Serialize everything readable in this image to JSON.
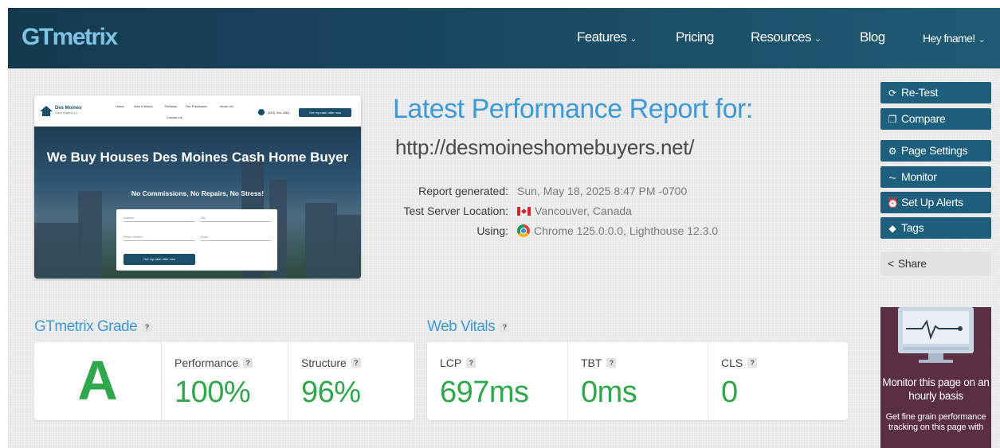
{
  "header": {
    "logo": "GTmetrix",
    "nav": [
      {
        "label": "Features",
        "dropdown": true
      },
      {
        "label": "Pricing",
        "dropdown": false
      },
      {
        "label": "Resources",
        "dropdown": true
      },
      {
        "label": "Blog",
        "dropdown": false
      },
      {
        "label": "Hey fname!",
        "dropdown": true
      }
    ],
    "chevron_glyph": "⌄"
  },
  "preview": {
    "brand_name": "Des Moines",
    "brand_sub": "Home Buyers LLC",
    "links": [
      "Home",
      "How it Works",
      "Reviews",
      "Our Purchases",
      "About Us",
      "Contact Us"
    ],
    "phone": "(515) 344-4361",
    "cta": "Get my cash offer now",
    "headline": "We Buy Houses Des Moines Cash Home Buyer",
    "subhead": "No Commissions, No Repairs, No Stress!",
    "form": {
      "address": "Address",
      "city": "City",
      "phone": "Phone Number",
      "email": "Email",
      "submit": "Get my cash offer now"
    }
  },
  "report": {
    "title": "Latest Performance Report for:",
    "url": "http://desmoineshomebuyers.net/",
    "meta": [
      {
        "label": "Report generated:",
        "value": "Sun, May 18, 2025 8:47 PM -0700"
      },
      {
        "label": "Test Server Location:",
        "value": "Vancouver, Canada"
      },
      {
        "label": "Using:",
        "value": "Chrome 125.0.0.0, Lighthouse 12.3.0"
      }
    ]
  },
  "sidebar": {
    "buttons": [
      {
        "label": "Re-Test",
        "icon": "refresh-icon",
        "glyph": "⟳"
      },
      {
        "label": "Compare",
        "icon": "copy-icon",
        "glyph": "❐"
      },
      {
        "label": "Page Settings",
        "icon": "gear-icon",
        "glyph": "⚙"
      },
      {
        "label": "Monitor",
        "icon": "pulse-icon",
        "glyph": "⏦"
      },
      {
        "label": "Set Up Alerts",
        "icon": "alarm-icon",
        "glyph": "⏰"
      },
      {
        "label": "Tags",
        "icon": "tag-icon",
        "glyph": "◆"
      }
    ],
    "share": {
      "label": "Share",
      "glyph": "<"
    },
    "promo": {
      "title": "Monitor this page on an hourly basis",
      "body": "Get fine grain performance tracking on this page with"
    }
  },
  "grade": {
    "heading": "GTmetrix Grade",
    "help": "?",
    "letter": "A",
    "performance_label": "Performance",
    "performance_value": "100%",
    "structure_label": "Structure",
    "structure_value": "96%"
  },
  "vitals": {
    "heading": "Web Vitals",
    "help": "?",
    "lcp_label": "LCP",
    "lcp_value": "697ms",
    "tbt_label": "TBT",
    "tbt_value": "0ms",
    "cls_label": "CLS",
    "cls_value": "0"
  },
  "colors": {
    "accent_blue": "#3d9ad6",
    "header_bg": "#14394f",
    "sidebar_button": "#1d5f7c",
    "good_green": "#2ea84a",
    "promo_bg": "#5a2e43"
  }
}
